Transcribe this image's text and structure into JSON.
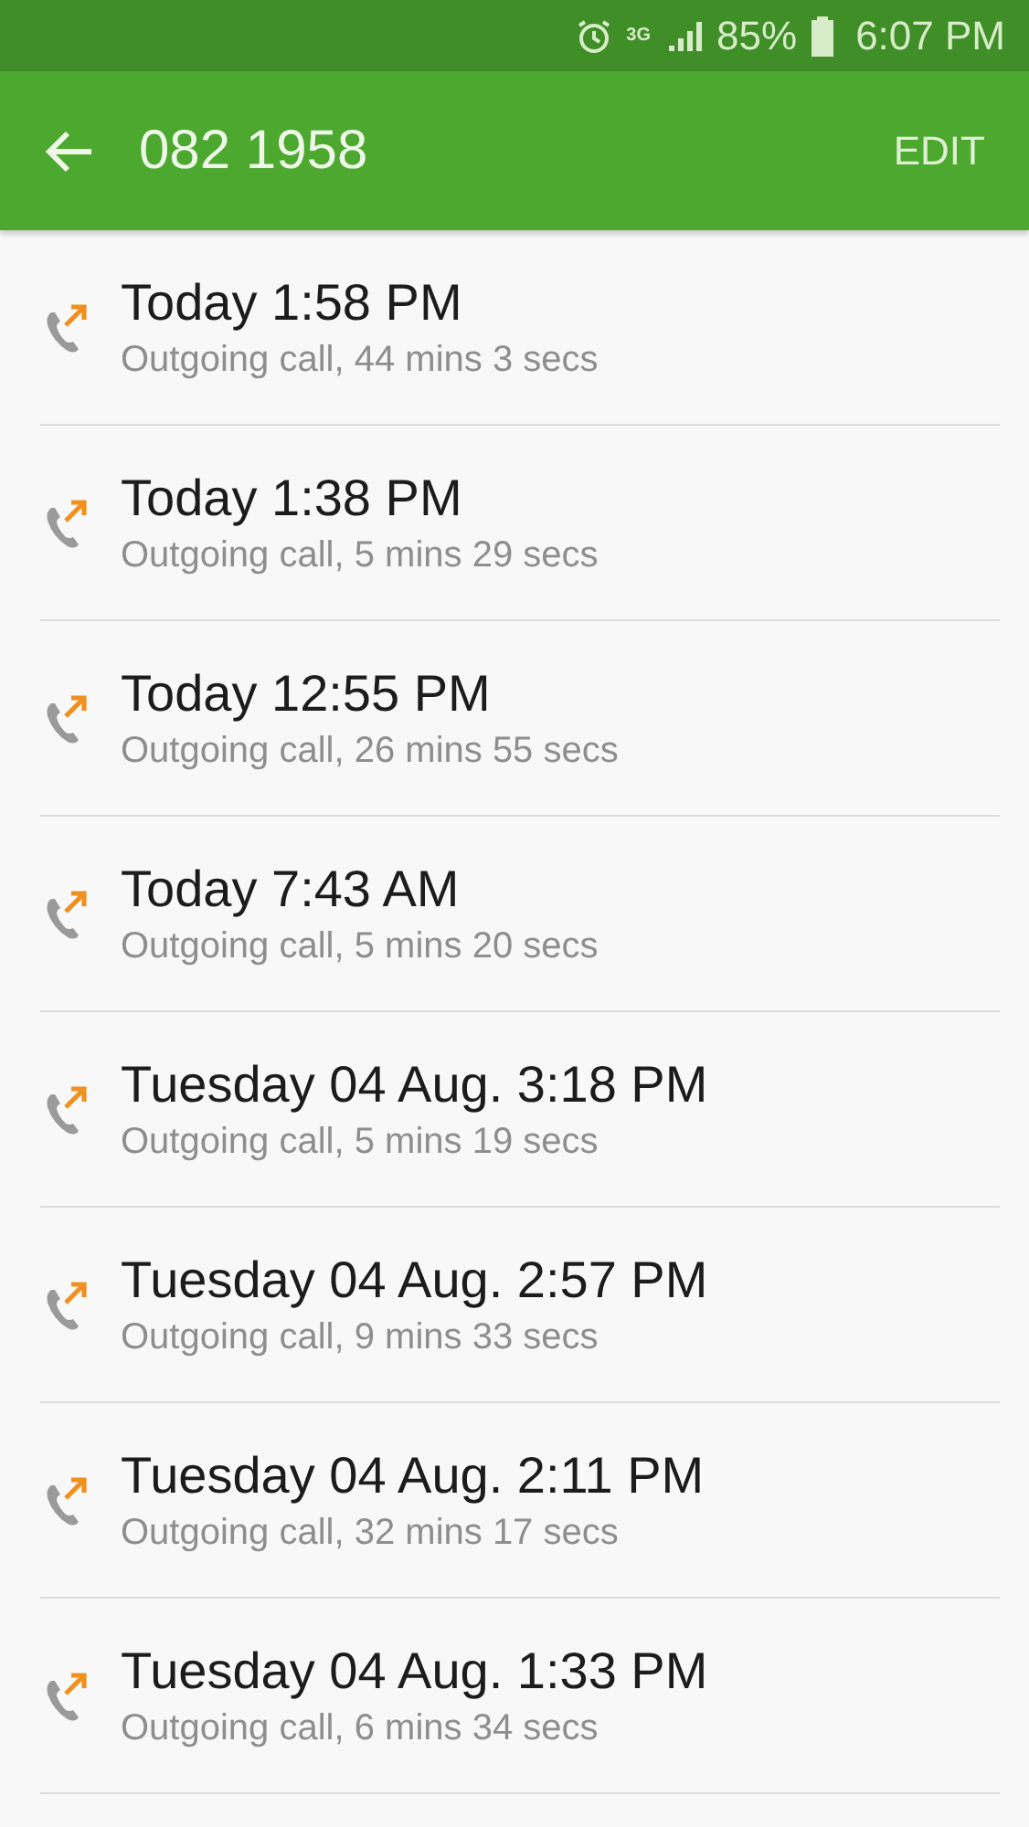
{
  "status_bar": {
    "network": "3G",
    "battery": "85%",
    "time": "6:07 PM"
  },
  "header": {
    "title": "082 1958",
    "action": "EDIT"
  },
  "calls": [
    {
      "kind": "outgoing",
      "time": "Today 1:58 PM",
      "detail": "Outgoing call, 44 mins 3 secs"
    },
    {
      "kind": "outgoing",
      "time": "Today 1:38 PM",
      "detail": "Outgoing call, 5 mins 29 secs"
    },
    {
      "kind": "outgoing",
      "time": "Today 12:55 PM",
      "detail": "Outgoing call, 26 mins 55 secs"
    },
    {
      "kind": "outgoing",
      "time": "Today 7:43 AM",
      "detail": "Outgoing call, 5 mins 20 secs"
    },
    {
      "kind": "outgoing",
      "time": "Tuesday 04 Aug. 3:18 PM",
      "detail": "Outgoing call, 5 mins 19 secs"
    },
    {
      "kind": "outgoing",
      "time": "Tuesday 04 Aug. 2:57 PM",
      "detail": "Outgoing call, 9 mins 33 secs"
    },
    {
      "kind": "outgoing",
      "time": "Tuesday 04 Aug. 2:11 PM",
      "detail": "Outgoing call, 32 mins 17 secs"
    },
    {
      "kind": "outgoing",
      "time": "Tuesday 04 Aug. 1:33 PM",
      "detail": "Outgoing call, 6 mins 34 secs"
    }
  ]
}
